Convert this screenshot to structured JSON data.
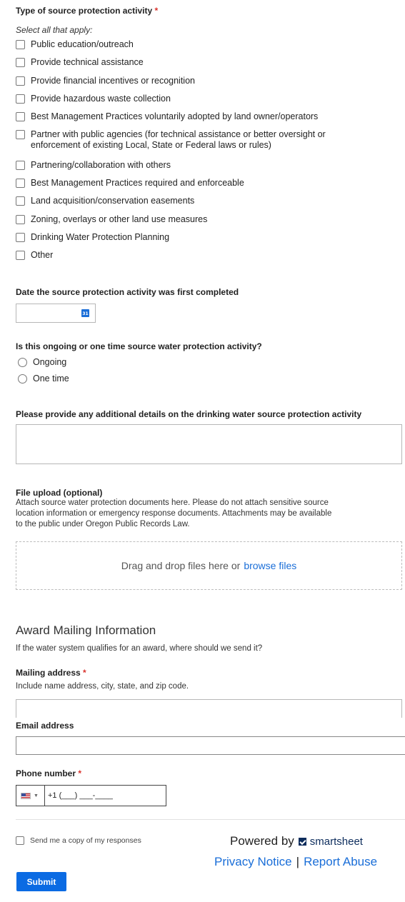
{
  "activity": {
    "label": "Type of source protection activity",
    "required_mark": "*",
    "hint": "Select all that apply:",
    "options": [
      "Public education/outreach",
      "Provide technical assistance",
      "Provide financial incentives or recognition",
      "Provide hazardous waste collection",
      "Best Management Practices voluntarily adopted by land owner/operators",
      "Partner with public agencies (for technical assistance or better oversight or",
      "enforcement of existing Local, State or Federal laws or rules)",
      "Partnering/collaboration with others",
      "Best Management Practices required and enforceable",
      "Land acquisition/conservation easements",
      "Zoning, overlays or other land use measures",
      "Drinking Water Protection Planning",
      "Other"
    ]
  },
  "date_field": {
    "label": "Date the source protection activity was first completed",
    "icon": "calendar-icon",
    "icon_text": "31"
  },
  "ongoing": {
    "label": "Is this ongoing or one time source water protection activity?",
    "options": [
      "Ongoing",
      "One time"
    ]
  },
  "details": {
    "label": "Please provide any additional details on the drinking water source protection activity"
  },
  "upload": {
    "label": "File upload (optional)",
    "description_lines": [
      "Attach source water protection documents here. Please do not attach sensitive source",
      "location information or emergency response documents. Attachments may be available",
      "to the public under Oregon Public Records Law."
    ],
    "drop_text": "Drag and drop files here or",
    "browse_text": "browse files"
  },
  "award": {
    "title": "Award Mailing Information",
    "subtitle": "If the water system qualifies for an award, where should we send it?"
  },
  "mailing": {
    "label": "Mailing address",
    "required_mark": "*",
    "hint": "Include name address, city, state, and zip code."
  },
  "email": {
    "label": "Email address"
  },
  "phone": {
    "label": "Phone number",
    "required_mark": "*",
    "value": "+1 (___) ___-____"
  },
  "copy": {
    "label": "Send me a copy of my responses"
  },
  "footer": {
    "powered_by": "Powered by",
    "brand": "smartsheet",
    "privacy": "Privacy Notice",
    "separator": "|",
    "report": "Report Abuse"
  },
  "submit_label": "Submit",
  "colors": {
    "accent": "#0b6be3",
    "required": "#d9322c",
    "link": "#1a6ed8"
  }
}
